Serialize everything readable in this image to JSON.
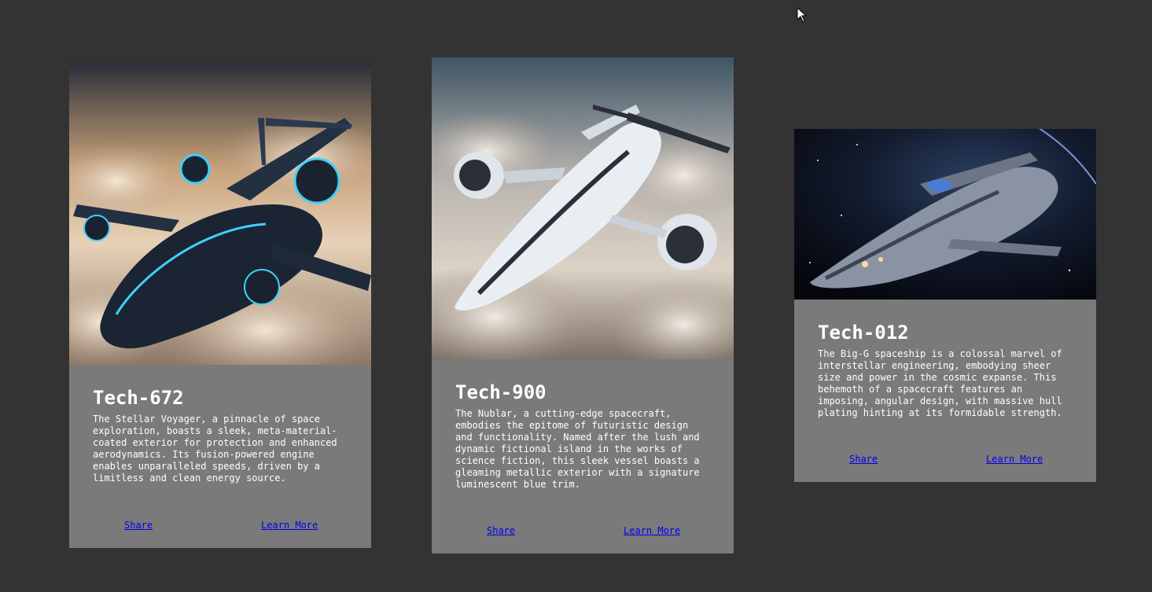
{
  "cards": [
    {
      "title": "Tech-672",
      "description": "The Stellar Voyager, a pinnacle of space exploration, boasts a sleek, meta-material-coated exterior for protection and enhanced aerodynamics. Its fusion-powered engine enables unparalleled speeds, driven by a limitless and clean energy source.",
      "share_label": "Share",
      "learn_more_label": "Learn More"
    },
    {
      "title": "Tech-900",
      "description": "The Nublar, a cutting-edge spacecraft, embodies the epitome of futuristic design and functionality. Named after the lush and dynamic fictional island in the works of science fiction, this sleek vessel boasts a gleaming metallic exterior with a signature luminescent blue trim.",
      "share_label": "Share",
      "learn_more_label": "Learn More"
    },
    {
      "title": "Tech-012",
      "description": "The Big-G spaceship is a colossal marvel of interstellar engineering, embodying sheer size and power in the cosmic expanse. This behemoth of a spacecraft features an imposing, angular design, with massive hull plating hinting at its formidable strength.",
      "share_label": "Share",
      "learn_more_label": "Learn More"
    }
  ],
  "colors": {
    "page_background": "#333333",
    "card_background": "#7a7a7a",
    "link": "#0000ee",
    "text": "#ffffff"
  }
}
